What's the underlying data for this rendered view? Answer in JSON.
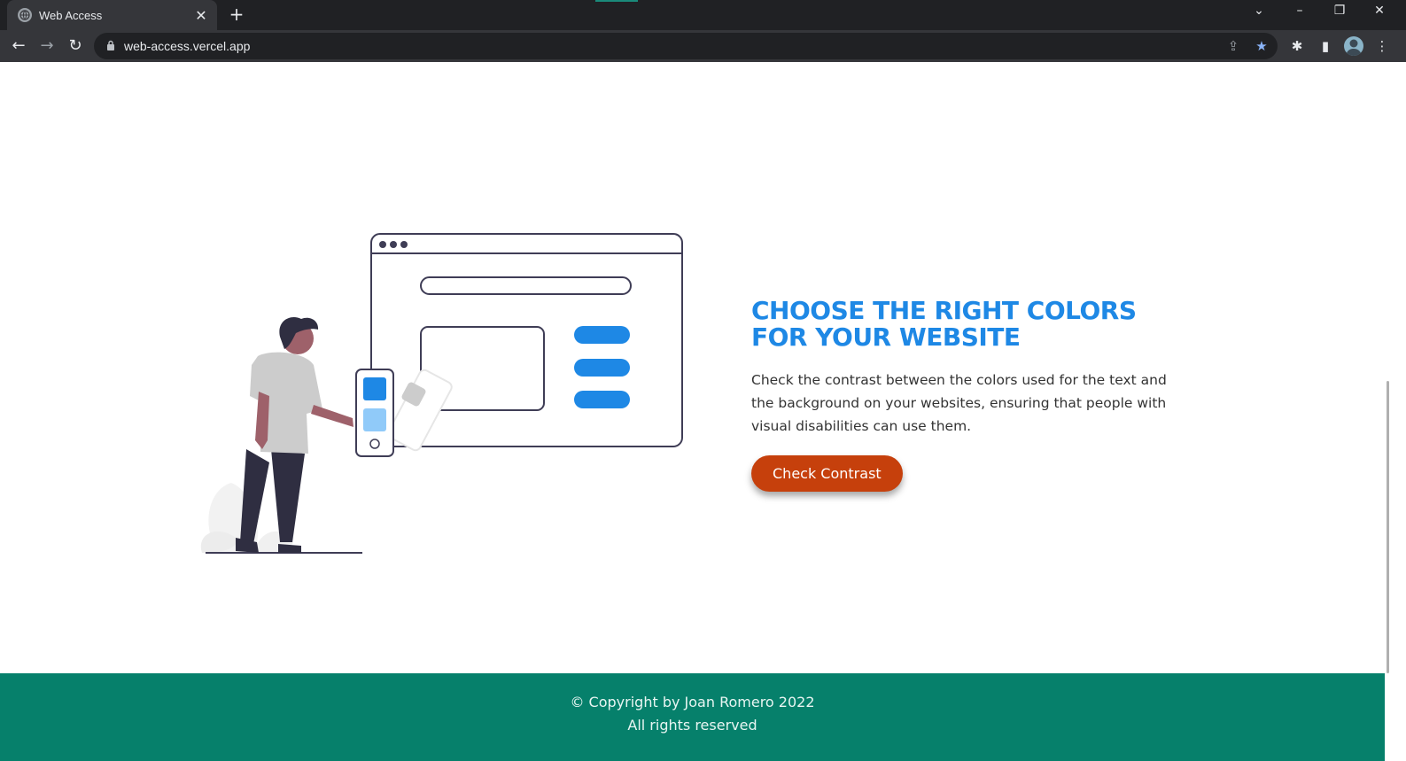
{
  "browser": {
    "tab_title": "Web Access",
    "new_tab_label": "+",
    "url": "web-access.vercel.app"
  },
  "hero": {
    "title": "CHOOSE THE RIGHT COLORS FOR YOUR WEBSITE",
    "description": "Check the contrast between the colors used for the text and the background on your websites, ensuring that people with visual disabilities can use them.",
    "cta_label": "Check Contrast"
  },
  "footer": {
    "copyright": "© Copyright by Joan Romero 2022",
    "rights": "All rights reserved"
  },
  "colors": {
    "accent_blue": "#1e88e5",
    "cta_orange": "#c6400c",
    "footer_green": "#06806b"
  }
}
